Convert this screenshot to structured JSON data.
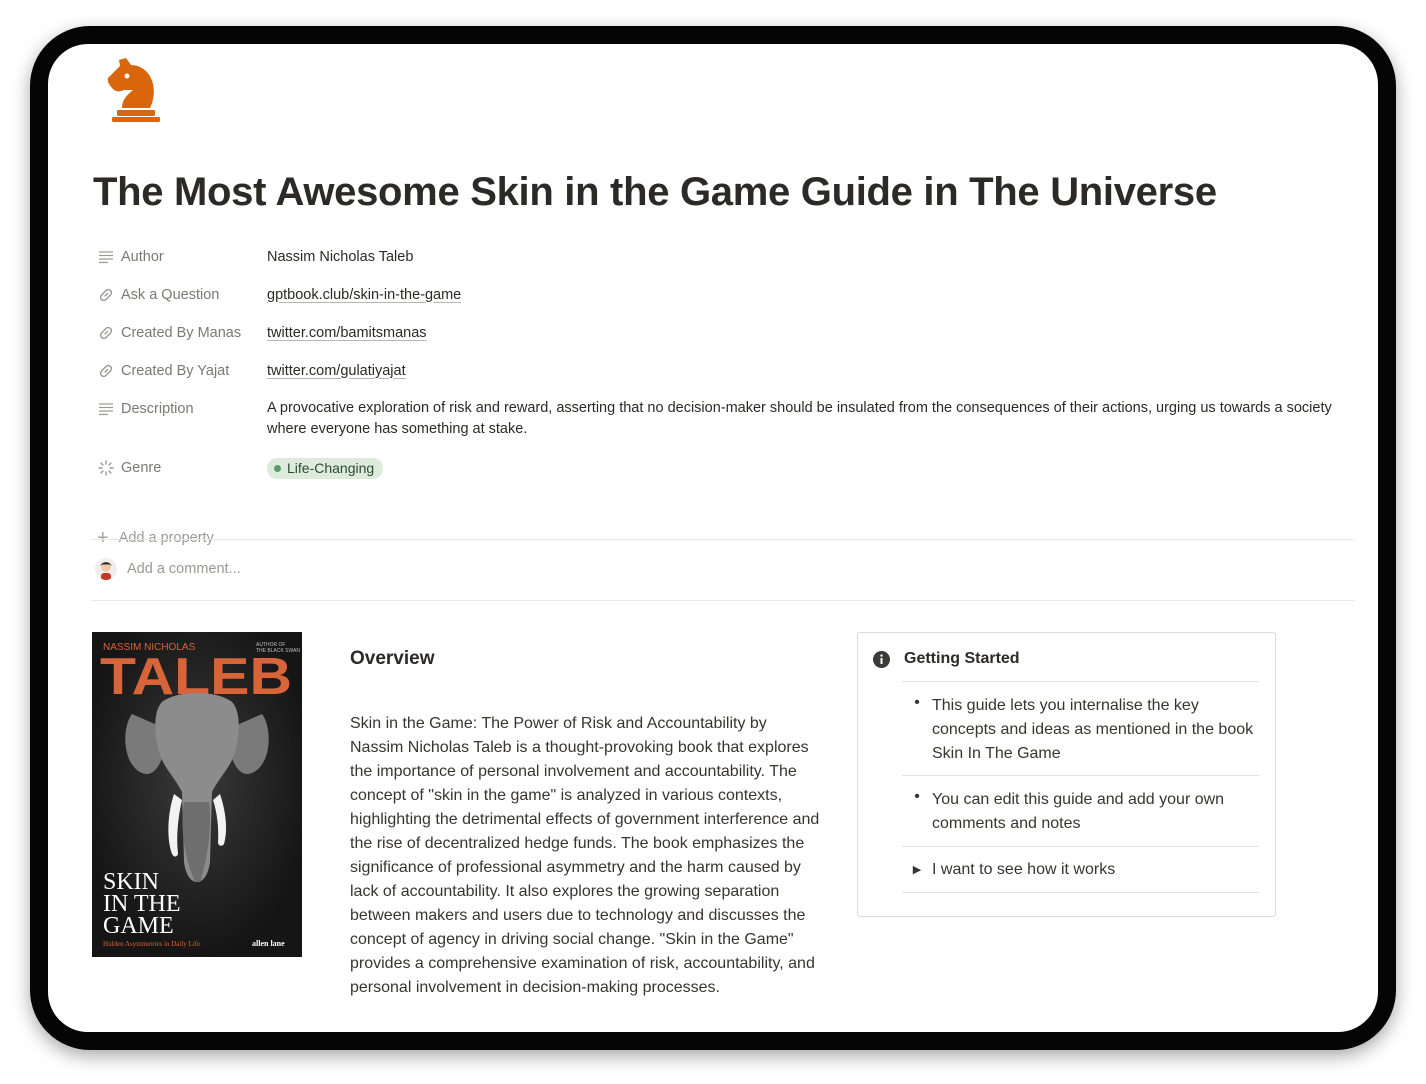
{
  "page": {
    "icon": "chess-knight-icon",
    "title": "The Most Awesome Skin in the Game Guide in The Universe"
  },
  "properties": [
    {
      "icon": "text-lines-icon",
      "label": "Author",
      "value": "Nassim Nicholas Taleb"
    },
    {
      "icon": "link-icon",
      "label": "Ask a Question",
      "value": "gptbook.club/skin-in-the-game"
    },
    {
      "icon": "link-icon",
      "label": "Created By Manas",
      "value": "twitter.com/bamitsmanas"
    },
    {
      "icon": "link-icon",
      "label": "Created By Yajat",
      "value": "twitter.com/gulatiyajat"
    },
    {
      "icon": "text-lines-icon",
      "label": "Description",
      "value": "A provocative exploration of risk and reward, asserting that no decision-maker should be insulated from the consequences of their actions, urging us towards a society where everyone has something at stake."
    },
    {
      "icon": "spinner-icon",
      "label": "Genre",
      "value": "Life-Changing"
    }
  ],
  "add_property_label": "Add a property",
  "comment": {
    "placeholder": "Add a comment..."
  },
  "cover": {
    "author_line": "NASSIM NICHOLAS",
    "author_big": "TALEB",
    "badge_line1": "AUTHOR OF",
    "badge_line2": "THE BLACK SWAN",
    "title_line1": "SKIN",
    "title_line2": "IN THE",
    "title_line3": "GAME",
    "subtitle": "Hidden Asymmetries in Daily Life",
    "publisher": "allen lane"
  },
  "overview": {
    "heading": "Overview",
    "text": "Skin in the Game: The Power of Risk and Accountability by Nassim Nicholas Taleb is a thought-provoking book that explores the importance of personal involvement and accountability. The concept of \"skin in the game\" is analyzed in various contexts, highlighting the detrimental effects of government interference and the rise of decentralized hedge funds. The book emphasizes the significance of professional asymmetry and the harm caused by lack of accountability. It also explores the growing separation between makers and users due to technology and discusses the concept of agency in driving social change. \"Skin in the Game\" provides a comprehensive examination of risk, accountability, and personal involvement in decision-making processes."
  },
  "callout": {
    "icon": "info-icon",
    "title": "Getting Started",
    "items": [
      {
        "marker": "•",
        "text": "This guide lets you internalise the key concepts and ideas as mentioned in the book Skin In The Game"
      },
      {
        "marker": "•",
        "text": "You can edit this guide and add your own comments and notes"
      },
      {
        "marker": "▶",
        "text": "I want to see how it works"
      }
    ]
  },
  "colors": {
    "icon_orange": "#d9650d",
    "tag_bg": "#dcebdc",
    "cover_orange": "#d8643a"
  }
}
